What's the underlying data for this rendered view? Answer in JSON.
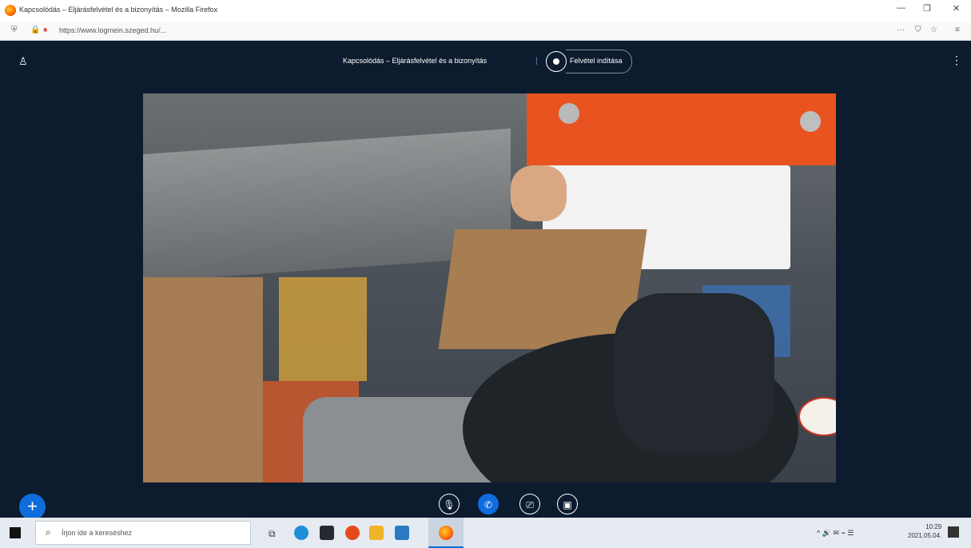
{
  "browser": {
    "window_title": "Kapcsolódás – Eljárásfelvétel és a bizonyítás – Mozilla Firefox",
    "url": "https://www.logmein.szeged.hu/...",
    "icons": {
      "shield": "shield-icon",
      "lock": "lock-icon",
      "more": "ellipsis-icon",
      "pocket": "pocket-icon",
      "bookmark": "star-icon",
      "menu": "hamburger-icon"
    },
    "window_controls": {
      "minimize": "—",
      "maximize": "❐",
      "close": "✕"
    }
  },
  "meeting": {
    "title": "Kapcsolódás – Eljárásfelvétel és a bizonyítás",
    "recording_label": "Felvétel indítása",
    "icons": {
      "participants": "user-icon",
      "more": "kebab-icon",
      "record": "record-icon"
    }
  },
  "controls": {
    "buttons": [
      {
        "name": "mic-off-button",
        "icon": "mic-off-icon",
        "glyph": "🎙"
      },
      {
        "name": "call-button",
        "icon": "phone-icon",
        "glyph": "✆"
      },
      {
        "name": "video-off-button",
        "icon": "camera-off-icon",
        "glyph": "⎚"
      },
      {
        "name": "share-button",
        "icon": "share-screen-icon",
        "glyph": "▣"
      }
    ],
    "add_button": "+"
  },
  "taskbar": {
    "search_placeholder": "Írjon ide a kereséshez",
    "apps": [
      "task-view-icon",
      "edge-icon",
      "store-icon",
      "office-icon",
      "explorer-icon",
      "mail-icon",
      "firefox-icon"
    ],
    "tray_text": "^ 🔊 ✉ ⌁ ☰",
    "clock_time": "10:29",
    "clock_date": "2021.05.04."
  },
  "colors": {
    "accent": "#0f6cdd",
    "background": "#0d1b2f",
    "taskbar": "#e6ebf1"
  }
}
